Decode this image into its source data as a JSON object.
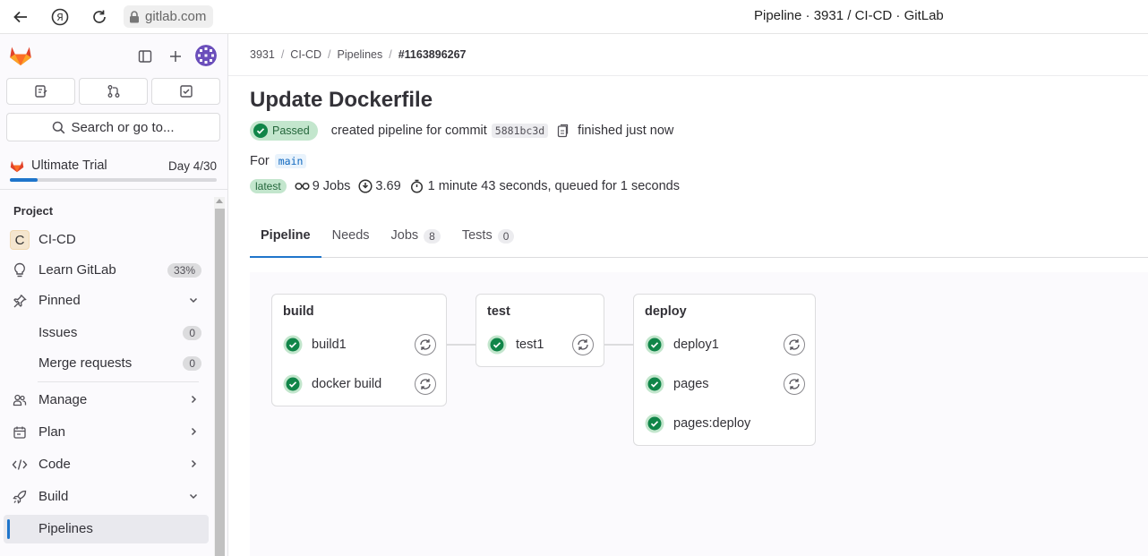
{
  "browser": {
    "url": "gitlab.com",
    "window_title": "Pipeline · 3931 / CI-CD · GitLab"
  },
  "sidebar": {
    "search_label": "Search or go to...",
    "trial": {
      "label": "Ultimate Trial",
      "day": "Day 4/30",
      "progress": 0.133
    },
    "section_title": "Project",
    "items": [
      {
        "label": "CI-CD",
        "icon": "project-letter-c",
        "letter": "C"
      },
      {
        "label": "Learn GitLab",
        "icon": "bulb-icon",
        "count": "33%"
      },
      {
        "label": "Pinned",
        "icon": "pin-icon",
        "chevron": "down"
      },
      {
        "label": "Issues",
        "count": "0"
      },
      {
        "label": "Merge requests",
        "count": "0"
      },
      {
        "label": "Manage",
        "icon": "users-icon",
        "chevron": "right"
      },
      {
        "label": "Plan",
        "icon": "calendar-icon",
        "chevron": "right"
      },
      {
        "label": "Code",
        "icon": "code-icon",
        "chevron": "right"
      },
      {
        "label": "Build",
        "icon": "rocket-icon",
        "chevron": "down"
      },
      {
        "label": "Pipelines",
        "active": true
      }
    ]
  },
  "breadcrumb": [
    "3931",
    "CI-CD",
    "Pipelines",
    "#1163896267"
  ],
  "pipeline": {
    "title": "Update Dockerfile",
    "status": "Passed",
    "created_text": "created pipeline for commit",
    "commit_sha": "5881bc3d",
    "finished_text": "finished just now",
    "for_label": "For",
    "branch": "main",
    "latest_badge": "latest",
    "jobs_text": "9 Jobs",
    "compute_text": "3.69",
    "duration_text": "1 minute 43 seconds, queued for 1 seconds"
  },
  "tabs": [
    {
      "label": "Pipeline",
      "active": true
    },
    {
      "label": "Needs"
    },
    {
      "label": "Jobs",
      "count": "8"
    },
    {
      "label": "Tests",
      "count": "0"
    }
  ],
  "stages": [
    {
      "name": "build",
      "jobs": [
        {
          "name": "build1",
          "status": "success",
          "retry": true
        },
        {
          "name": "docker build",
          "status": "success",
          "retry": true
        }
      ]
    },
    {
      "name": "test",
      "jobs": [
        {
          "name": "test1",
          "status": "success",
          "retry": true
        }
      ]
    },
    {
      "name": "deploy",
      "jobs": [
        {
          "name": "deploy1",
          "status": "success",
          "retry": true
        },
        {
          "name": "pages",
          "status": "success",
          "retry": true
        },
        {
          "name": "pages:deploy",
          "status": "success",
          "retry": false
        }
      ]
    }
  ],
  "colors": {
    "accent": "#1f75cb",
    "success": "#108548",
    "success_bg": "#c3e6cd"
  }
}
